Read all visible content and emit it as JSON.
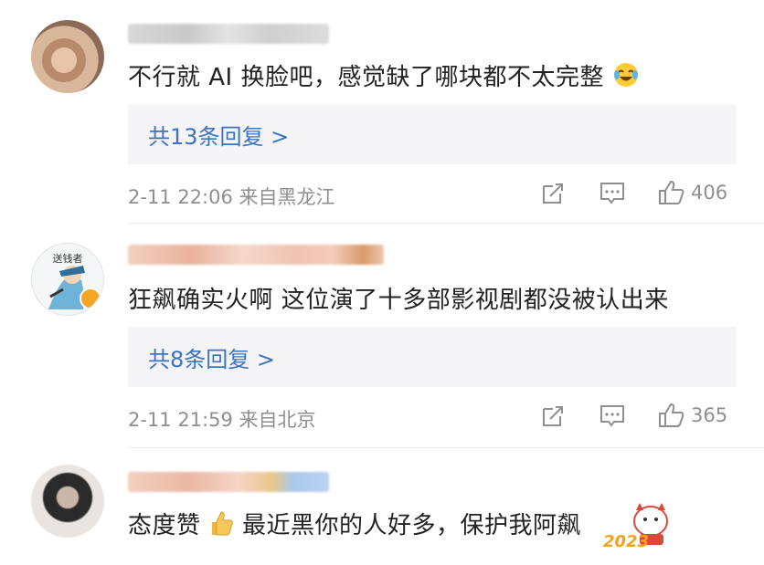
{
  "comments": [
    {
      "text": "不行就 AI 换脸吧，感觉缺了哪块都不太完整",
      "emoji": "laughing-crying-emoji",
      "replies_label": "共13条回复 >",
      "timestamp": "2-11 22:06",
      "location": "来自黑龙江",
      "likes": "406"
    },
    {
      "avatar_text": "送钱者",
      "text": "狂飙确实火啊 这位演了十多部影视剧都没被认出来",
      "replies_label": "共8条回复 >",
      "timestamp": "2-11 21:59",
      "location": "来自北京",
      "likes": "365"
    },
    {
      "text_part1": "态度赞",
      "emoji": "thumbs-up-emoji",
      "text_part2": "最近黑你的人好多，保护我阿飙",
      "sticker_text": "2023"
    }
  ],
  "colors": {
    "link": "#3b72c6",
    "meta": "#8f8f8f",
    "reply_bg": "#f5f5f7",
    "verified": "#f5a623"
  }
}
